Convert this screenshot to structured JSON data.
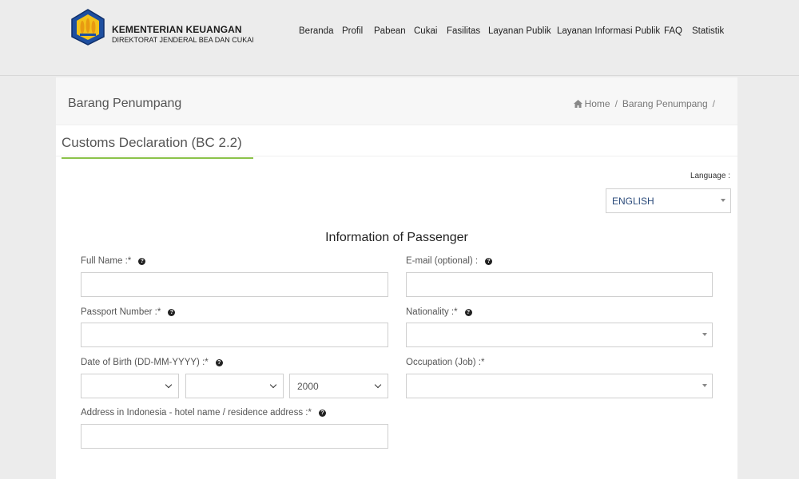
{
  "header": {
    "org_line1": "KEMENTERIAN KEUANGAN",
    "org_line2": "DIREKTORAT JENDERAL BEA DAN CUKAI",
    "nav": [
      "Beranda",
      "Profil",
      "Pabean",
      "Cukai",
      "Fasilitas",
      "Layanan Publik",
      "Layanan Informasi Publik",
      "FAQ",
      "Statistik"
    ]
  },
  "page": {
    "title": "Barang Penumpang",
    "breadcrumb": {
      "home": "Home",
      "current": "Barang Penumpang",
      "separator": "/"
    }
  },
  "form_tab": {
    "title": "Customs Declaration (BC 2.2)"
  },
  "language": {
    "label": "Language :",
    "value": "ENGLISH"
  },
  "section": {
    "title": "Information of Passenger"
  },
  "fields": {
    "full_name": {
      "label": "Full Name :*",
      "value": ""
    },
    "email": {
      "label": "E-mail (optional) :",
      "value": ""
    },
    "passport": {
      "label": "Passport Number :*",
      "value": ""
    },
    "nationality": {
      "label": "Nationality :*",
      "value": ""
    },
    "dob": {
      "label": "Date of Birth (DD-MM-YYYY) :*",
      "day": "",
      "month": "",
      "year": "2000"
    },
    "occupation": {
      "label": "Occupation (Job) :*",
      "value": ""
    },
    "address": {
      "label": "Address in Indonesia - hotel name / residence address :*",
      "value": ""
    }
  },
  "colors": {
    "accent": "#8bc34a",
    "header_bg": "#ececec",
    "language_text": "#2a4a7a"
  },
  "icons": {
    "help": "question-circle-icon",
    "home": "home-icon"
  }
}
